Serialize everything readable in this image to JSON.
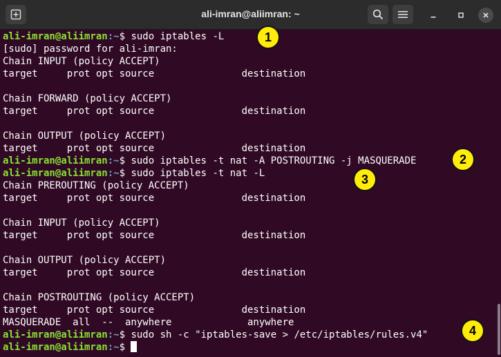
{
  "window": {
    "title": "ali-imran@aliimran: ~"
  },
  "icons": {
    "new_tab": "new-tab-icon",
    "search": "search-icon",
    "menu": "hamburger-menu-icon",
    "minimize": "minimize-icon",
    "maximize": "maximize-icon",
    "close": "close-icon"
  },
  "colors": {
    "terminal_bg": "#300a24",
    "prompt_user": "#8ae234",
    "prompt_path": "#729fcf",
    "badge": "#ffec0a"
  },
  "terminal": {
    "prompt_user": "ali-imran@aliimran",
    "prompt_path": ":~",
    "prompt_suffix": "$ ",
    "lines": [
      {
        "type": "cmd",
        "text": "sudo iptables -L"
      },
      {
        "type": "out",
        "text": "[sudo] password for ali-imran:"
      },
      {
        "type": "out",
        "text": "Chain INPUT (policy ACCEPT)"
      },
      {
        "type": "out",
        "text": "target     prot opt source               destination"
      },
      {
        "type": "out",
        "text": ""
      },
      {
        "type": "out",
        "text": "Chain FORWARD (policy ACCEPT)"
      },
      {
        "type": "out",
        "text": "target     prot opt source               destination"
      },
      {
        "type": "out",
        "text": ""
      },
      {
        "type": "out",
        "text": "Chain OUTPUT (policy ACCEPT)"
      },
      {
        "type": "out",
        "text": "target     prot opt source               destination"
      },
      {
        "type": "cmd",
        "text": "sudo iptables -t nat -A POSTROUTING -j MASQUERADE"
      },
      {
        "type": "cmd",
        "text": "sudo iptables -t nat -L"
      },
      {
        "type": "out",
        "text": "Chain PREROUTING (policy ACCEPT)"
      },
      {
        "type": "out",
        "text": "target     prot opt source               destination"
      },
      {
        "type": "out",
        "text": ""
      },
      {
        "type": "out",
        "text": "Chain INPUT (policy ACCEPT)"
      },
      {
        "type": "out",
        "text": "target     prot opt source               destination"
      },
      {
        "type": "out",
        "text": ""
      },
      {
        "type": "out",
        "text": "Chain OUTPUT (policy ACCEPT)"
      },
      {
        "type": "out",
        "text": "target     prot opt source               destination"
      },
      {
        "type": "out",
        "text": ""
      },
      {
        "type": "out",
        "text": "Chain POSTROUTING (policy ACCEPT)"
      },
      {
        "type": "out",
        "text": "target     prot opt source               destination"
      },
      {
        "type": "out",
        "text": "MASQUERADE  all  --  anywhere             anywhere"
      },
      {
        "type": "cmd",
        "text": "sudo sh -c \"iptables-save > /etc/iptables/rules.v4\""
      },
      {
        "type": "cursor",
        "text": ""
      }
    ]
  },
  "badges": [
    "1",
    "2",
    "3",
    "4"
  ]
}
